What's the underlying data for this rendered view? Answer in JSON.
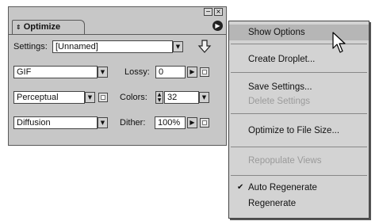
{
  "palette": {
    "tab_label": "Optimize",
    "settings": {
      "label": "Settings:",
      "value": "[Unnamed]"
    },
    "format": {
      "value": "GIF"
    },
    "lossy": {
      "label": "Lossy:",
      "value": "0"
    },
    "reduction": {
      "value": "Perceptual"
    },
    "colors": {
      "label": "Colors:",
      "value": "32"
    },
    "dither_algorithm": {
      "value": "Diffusion"
    },
    "dither": {
      "label": "Dither:",
      "value": "100%"
    }
  },
  "menu": {
    "items": [
      {
        "label": "Show Options",
        "enabled": true,
        "highlighted": true,
        "checked": false
      },
      {
        "label": "Create Droplet...",
        "enabled": true,
        "highlighted": false,
        "checked": false
      },
      {
        "label": "Save Settings...",
        "enabled": true,
        "highlighted": false,
        "checked": false
      },
      {
        "label": "Delete Settings",
        "enabled": false,
        "highlighted": false,
        "checked": false
      },
      {
        "label": "Optimize to File Size...",
        "enabled": true,
        "highlighted": false,
        "checked": false
      },
      {
        "label": "Repopulate Views",
        "enabled": false,
        "highlighted": false,
        "checked": false
      },
      {
        "label": "Auto Regenerate",
        "enabled": true,
        "highlighted": false,
        "checked": true
      },
      {
        "label": "Regenerate",
        "enabled": true,
        "highlighted": false,
        "checked": false
      }
    ]
  },
  "colors": {
    "panel_bg": "#c7c7c7",
    "menu_bg": "#d3d3d3",
    "highlight": "#b6b6b6",
    "disabled_text": "#9a9a9a"
  }
}
